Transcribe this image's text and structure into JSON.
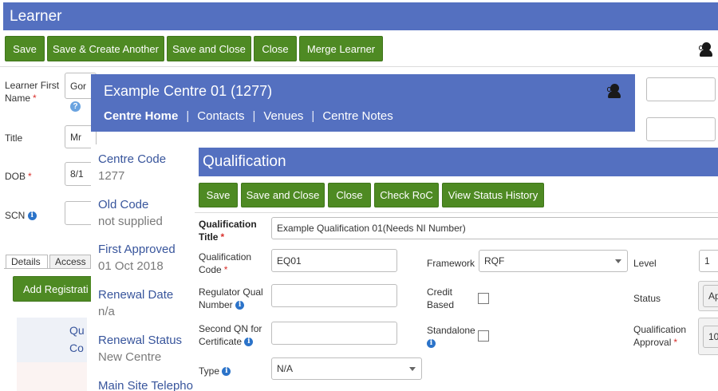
{
  "learner": {
    "title": "Learner",
    "toolbar": {
      "save": "Save",
      "save_create": "Save & Create Another",
      "save_close": "Save and Close",
      "close": "Close",
      "merge": "Merge Learner"
    },
    "fields": {
      "first_name_label": "Learner First Name",
      "first_name_value": "Gor",
      "title_label": "Title",
      "title_value": "Mr",
      "dob_label": "DOB",
      "dob_value": "8/1",
      "scn_label": "SCN"
    },
    "tabs": [
      "Details",
      "Access"
    ],
    "add_registration": "Add Registrati",
    "panel_lines": [
      "Qu",
      "Co"
    ]
  },
  "centre": {
    "title": "Example Centre 01 (1277)",
    "nav": [
      "Centre Home",
      "Contacts",
      "Venues",
      "Centre Notes"
    ],
    "fields": [
      {
        "label": "Centre Code",
        "value": "1277"
      },
      {
        "label": "Old Code",
        "value": "not supplied"
      },
      {
        "label": "First Approved",
        "value": "01 Oct 2018"
      },
      {
        "label": "Renewal Date",
        "value": "n/a"
      },
      {
        "label": "Renewal Status",
        "value": "New Centre"
      },
      {
        "label": "Main Site Telepho",
        "value": ""
      }
    ]
  },
  "qualification": {
    "title": "Qualification",
    "toolbar": {
      "save": "Save",
      "save_close": "Save and Close",
      "close": "Close",
      "check_roc": "Check RoC",
      "view_status": "View Status History"
    },
    "fields": {
      "title_label": "Qualification Title",
      "title_value": "Example Qualification 01(Needs NI Number)",
      "code_label": "Qualification Code",
      "code_value": "EQ01",
      "framework_label": "Framework",
      "framework_value": "RQF",
      "level_label": "Level",
      "level_value": "1",
      "regulator_label": "Regulator Qual Number",
      "credit_label": "Credit Based",
      "status_label": "Status",
      "status_value": "Ap",
      "second_qn_label": "Second QN for Certificate",
      "standalone_label": "Standalone",
      "approval_label": "Qualification Approval",
      "approval_value": "10",
      "type_label": "Type",
      "type_value": "N/A"
    }
  },
  "colors": {
    "header_blue": "#5470c0",
    "button_green": "#4e8a23",
    "required_red": "#d9302c",
    "link_blue": "#38559c"
  },
  "icons": [
    "user-icon",
    "info-icon",
    "help-icon",
    "chevron-down-icon"
  ]
}
